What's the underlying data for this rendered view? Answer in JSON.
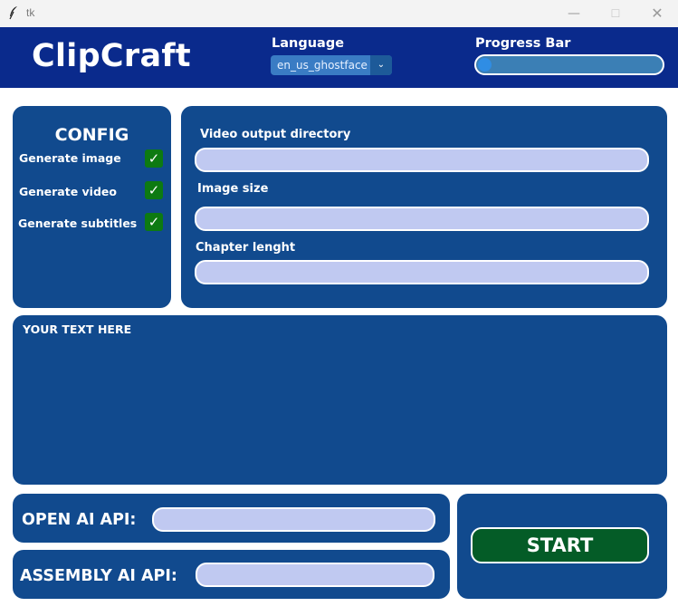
{
  "window": {
    "title": "tk",
    "minimize": "—",
    "maximize": "☐",
    "close": "✕"
  },
  "header": {
    "logo": "ClipCraft",
    "language_label": "Language",
    "language_value": "en_us_ghostface",
    "progress_label": "Progress Bar",
    "progress_fraction": 0.0
  },
  "config": {
    "title": "CONFIG",
    "options": [
      {
        "label": "Generate image",
        "checked": true
      },
      {
        "label": "Generate video",
        "checked": true
      },
      {
        "label": "Generate subtitles",
        "checked": true
      }
    ],
    "checkmark": "✓"
  },
  "settings": {
    "video_dir_label": "Video output directory",
    "video_dir_value": "",
    "image_size_label": "Image size",
    "image_size_value": "",
    "chapter_label": "Chapter lenght",
    "chapter_value": ""
  },
  "text_area": {
    "label": "YOUR TEXT HERE",
    "value": ""
  },
  "api": {
    "openai_label": "OPEN AI API:",
    "openai_value": "",
    "assembly_label": "ASSEMBLY AI API:",
    "assembly_value": ""
  },
  "start_label": "START",
  "colors": {
    "header": "#0a2a8c",
    "panel": "#114a8e",
    "field": "#c0c9f1",
    "start": "#045c27",
    "check": "#0d7a12"
  }
}
